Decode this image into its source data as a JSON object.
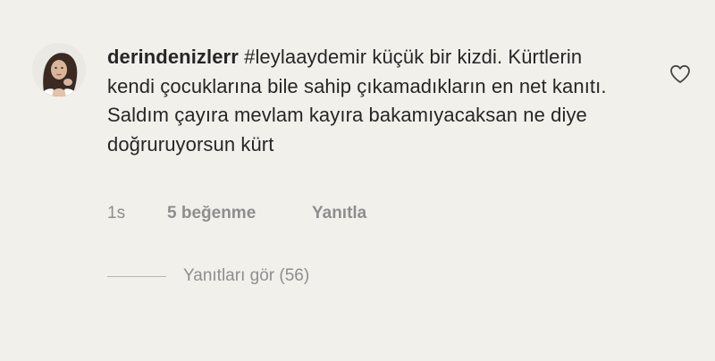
{
  "comment": {
    "username": "derindenizlerr",
    "text": "#leylaaydemir küçük bir kizdi. Kürtlerin kendi çocuklarına bile sahip çıkamadıkların en net kanıtı. Saldım çayıra mevlam kayıra bakamıyacaksan ne diye doğruruyorsun kürt",
    "time": "1s",
    "likes": "5 beğenme",
    "reply_label": "Yanıtla",
    "view_replies_label": "Yanıtları gör (56)"
  },
  "icons": {
    "like": "heart-outline-icon",
    "avatar": "user-avatar-photo"
  },
  "colors": {
    "background": "#f1f0eb",
    "text": "#262626",
    "secondary": "#8e8e8e"
  }
}
